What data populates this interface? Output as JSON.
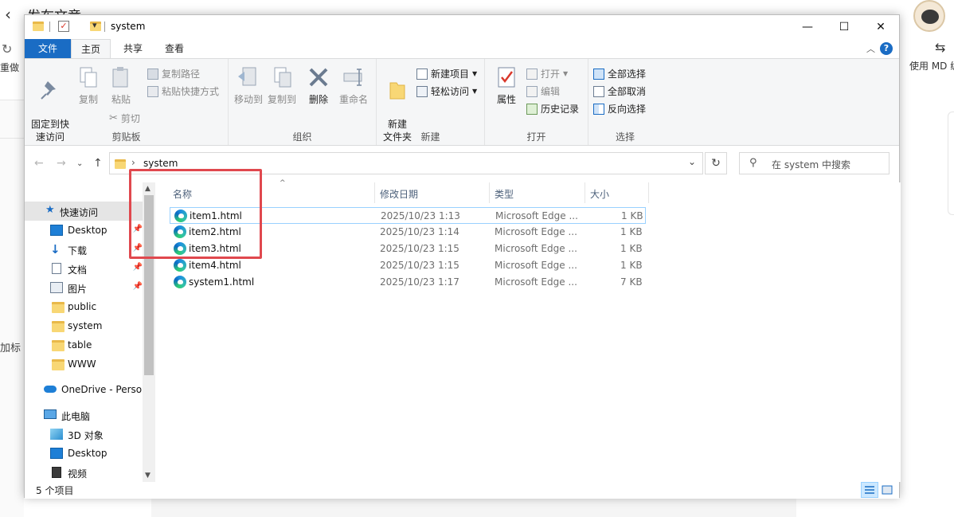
{
  "background": {
    "title": "发布文章",
    "redo_label": "重做",
    "add_tag_label": "加标",
    "md_label": "使用 MD 编"
  },
  "window": {
    "title": "system",
    "controls": {
      "minimize": "—",
      "maximize": "☐",
      "close": "✕"
    }
  },
  "tabs": [
    {
      "label": "文件"
    },
    {
      "label": "主页"
    },
    {
      "label": "共享"
    },
    {
      "label": "查看"
    }
  ],
  "ribbon": {
    "clipboard": {
      "label": "剪贴板",
      "pin_label": "固定到快\n速访问",
      "copy_label": "复制",
      "paste_label": "粘贴",
      "copy_path": "复制路径",
      "paste_shortcut": "粘贴快捷方式",
      "cut": "剪切"
    },
    "organize": {
      "label": "组织",
      "move_to": "移动到",
      "copy_to": "复制到",
      "delete": "删除",
      "rename": "重命名"
    },
    "new": {
      "label": "新建",
      "new_folder": "新建\n文件夹",
      "new_item": "新建项目",
      "easy_access": "轻松访问"
    },
    "open": {
      "label": "打开",
      "properties": "属性",
      "open": "打开",
      "edit": "编辑",
      "history": "历史记录"
    },
    "select": {
      "label": "选择",
      "select_all": "全部选择",
      "select_none": "全部取消",
      "invert": "反向选择"
    }
  },
  "address": {
    "path": "system",
    "search_placeholder": "在 system 中搜索"
  },
  "nav": {
    "items": [
      {
        "label": "快速访问",
        "icon": "star-icon",
        "pinned": false
      },
      {
        "label": "Desktop",
        "icon": "desktop-icon",
        "pinned": true
      },
      {
        "label": "下载",
        "icon": "download-icon",
        "pinned": true
      },
      {
        "label": "文档",
        "icon": "document-icon",
        "pinned": true
      },
      {
        "label": "图片",
        "icon": "picture-icon",
        "pinned": true
      },
      {
        "label": "public",
        "icon": "folder-icon",
        "pinned": false
      },
      {
        "label": "system",
        "icon": "folder-icon",
        "pinned": false
      },
      {
        "label": "table",
        "icon": "folder-icon",
        "pinned": false
      },
      {
        "label": "WWW",
        "icon": "folder-icon",
        "pinned": false
      },
      {
        "label": "OneDrive - Person",
        "icon": "cloud-icon",
        "pinned": false
      },
      {
        "label": "此电脑",
        "icon": "computer-icon",
        "pinned": false
      },
      {
        "label": "3D 对象",
        "icon": "cube-icon",
        "pinned": false
      },
      {
        "label": "Desktop",
        "icon": "desktop-icon",
        "pinned": false
      },
      {
        "label": "视频",
        "icon": "video-icon",
        "pinned": false
      }
    ]
  },
  "columns": {
    "name": "名称",
    "date": "修改日期",
    "type": "类型",
    "size": "大小"
  },
  "files": [
    {
      "name": "item1.html",
      "date": "2025/10/23 1:13",
      "type": "Microsoft Edge ...",
      "size": "1 KB"
    },
    {
      "name": "item2.html",
      "date": "2025/10/23 1:14",
      "type": "Microsoft Edge ...",
      "size": "1 KB"
    },
    {
      "name": "item3.html",
      "date": "2025/10/23 1:15",
      "type": "Microsoft Edge ...",
      "size": "1 KB"
    },
    {
      "name": "item4.html",
      "date": "2025/10/23 1:15",
      "type": "Microsoft Edge ...",
      "size": "1 KB"
    },
    {
      "name": "system1.html",
      "date": "2025/10/23 1:17",
      "type": "Microsoft Edge ...",
      "size": "7 KB"
    }
  ],
  "status": {
    "count_text": "5 个项目"
  },
  "colors": {
    "accent": "#1a6cc4",
    "highlight": "#e0484e",
    "folder": "#f8d775"
  }
}
